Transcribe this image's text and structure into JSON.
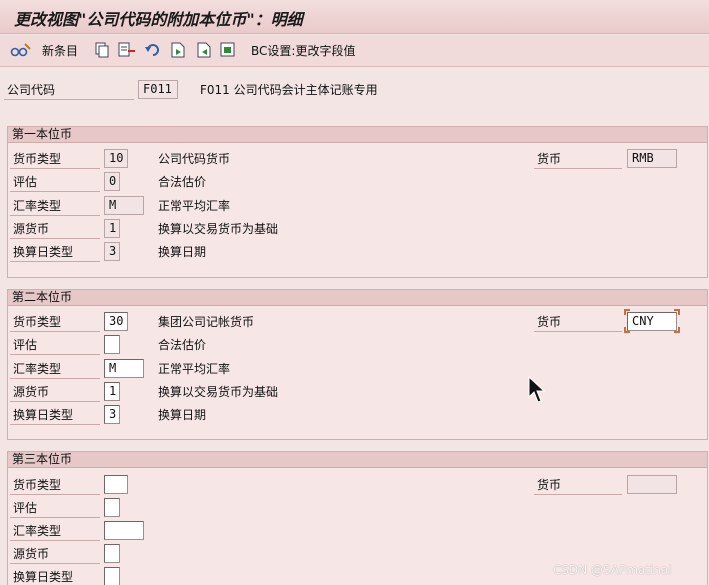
{
  "window": {
    "title": "更改视图\"公司代码的附加本位币\"：明细"
  },
  "toolbar": {
    "new_entries": "新条目",
    "bc_settings": "BC设置:更改字段值"
  },
  "company": {
    "label": "公司代码",
    "value": "F011",
    "description": "F011 公司代码会计主体记账专用"
  },
  "groups": [
    {
      "title": "第一本位币",
      "rows": [
        {
          "label": "货币类型",
          "value": "10",
          "desc": "公司代码货币"
        },
        {
          "label": "评估",
          "value": "0",
          "desc": "合法估价"
        },
        {
          "label": "汇率类型",
          "value": "M",
          "desc": "正常平均汇率"
        },
        {
          "label": "源货币",
          "value": "1",
          "desc": "换算以交易货币为基础"
        },
        {
          "label": "换算日类型",
          "value": "3",
          "desc": "换算日期"
        }
      ],
      "currency_label": "货币",
      "currency_value": "RMB"
    },
    {
      "title": "第二本位币",
      "rows": [
        {
          "label": "货币类型",
          "value": "30",
          "desc": "集团公司记帐货币"
        },
        {
          "label": "评估",
          "value": "",
          "desc": "合法估价"
        },
        {
          "label": "汇率类型",
          "value": "M",
          "desc": "正常平均汇率"
        },
        {
          "label": "源货币",
          "value": "1",
          "desc": "换算以交易货币为基础"
        },
        {
          "label": "换算日类型",
          "value": "3",
          "desc": "换算日期"
        }
      ],
      "currency_label": "货币",
      "currency_value": "CNY"
    },
    {
      "title": "第三本位币",
      "rows": [
        {
          "label": "货币类型",
          "value": ""
        },
        {
          "label": "评估",
          "value": ""
        },
        {
          "label": "汇率类型",
          "value": ""
        },
        {
          "label": "源货币",
          "value": ""
        },
        {
          "label": "换算日类型",
          "value": ""
        }
      ],
      "currency_label": "货币",
      "currency_value": ""
    }
  ],
  "watermark": "CSDN @SAPmatinal",
  "icons": [
    "glasses-icon",
    "copy-icon",
    "delete-icon",
    "undo-icon",
    "select-all-icon",
    "deselect-icon",
    "block-icon"
  ]
}
